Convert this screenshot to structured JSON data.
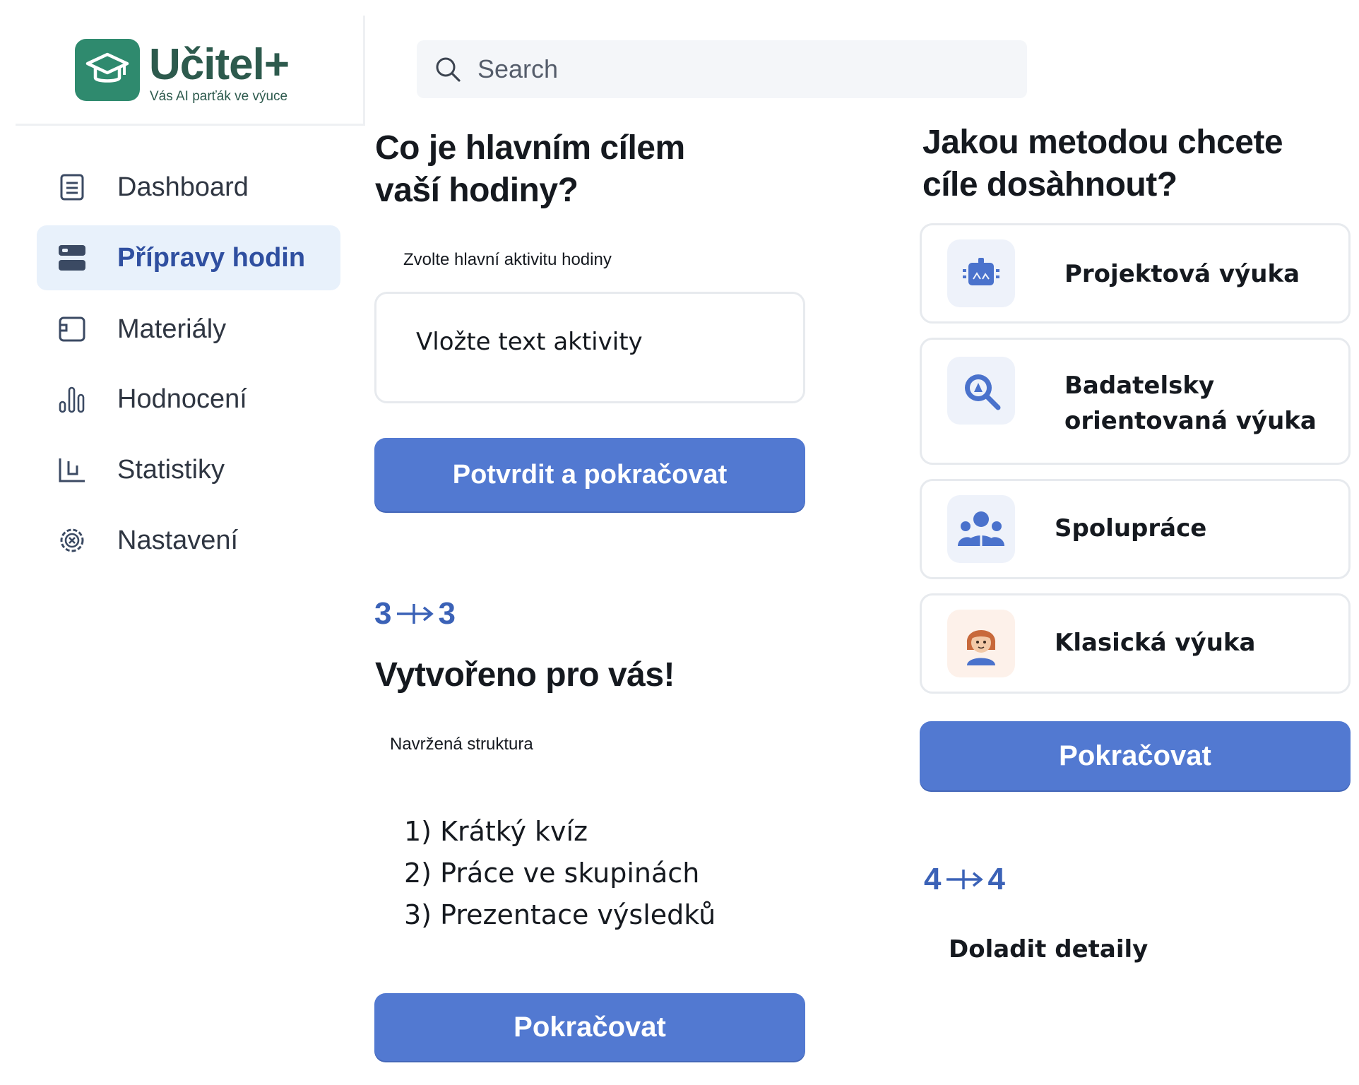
{
  "app": {
    "name": "Učitel+",
    "tagline": "Vás AI parťák ve výuce"
  },
  "search": {
    "placeholder": "Search"
  },
  "sidebar": {
    "items": [
      {
        "label": "Dashboard",
        "icon": "document-list-icon",
        "active": false
      },
      {
        "label": "Přípravy hodin",
        "icon": "server-stack-icon",
        "active": true
      },
      {
        "label": "Materiály",
        "icon": "folder-tab-icon",
        "active": false
      },
      {
        "label": "Hodnocení",
        "icon": "bar-chart-icon",
        "active": false
      },
      {
        "label": "Statistiky",
        "icon": "line-chart-icon",
        "active": false
      },
      {
        "label": "Nastavení",
        "icon": "gear-icon",
        "active": false
      }
    ]
  },
  "goal_step": {
    "title_line1": "Co je hlavním cílem",
    "title_line2": "vaší hodiny?",
    "activity_label": "Zvolte hlavní aktivitu hodiny",
    "activity_value": "Vložte text aktivity",
    "confirm_button": "Potvrdit a pokračovat"
  },
  "result_step": {
    "step_from": "3",
    "step_to": "3",
    "title": "Vytvořeno pro vás!",
    "structure_label": "Navržená struktura",
    "structure_items": [
      "1) Krátký kvíz",
      "2) Práce ve skupinách",
      "3) Prezentace výsledků"
    ],
    "continue_button": "Pokračovat"
  },
  "method_step": {
    "title_line1": "Jakou metodou chcete",
    "title_line2": "cíle dosàhnout?",
    "methods": [
      {
        "label": "Projektová výuka",
        "icon": "robot-project-icon"
      },
      {
        "label_line1": "Badatelsky",
        "label_line2": "orientovaná výuka",
        "icon": "magnifier-icon"
      },
      {
        "label": "Spolupráce",
        "icon": "group-people-icon"
      },
      {
        "label": "Klasická výuka",
        "icon": "teacher-face-icon"
      }
    ],
    "continue_button": "Pokračovat"
  },
  "detail_step": {
    "step_from": "4",
    "step_to": "4",
    "title": "Doladit detaily"
  },
  "colors": {
    "brand_green": "#2f8a6e",
    "brand_text": "#2d5a4d",
    "primary_button": "#5279d1",
    "active_nav_bg": "#e8f1fb",
    "step_blue": "#3b62b7"
  }
}
